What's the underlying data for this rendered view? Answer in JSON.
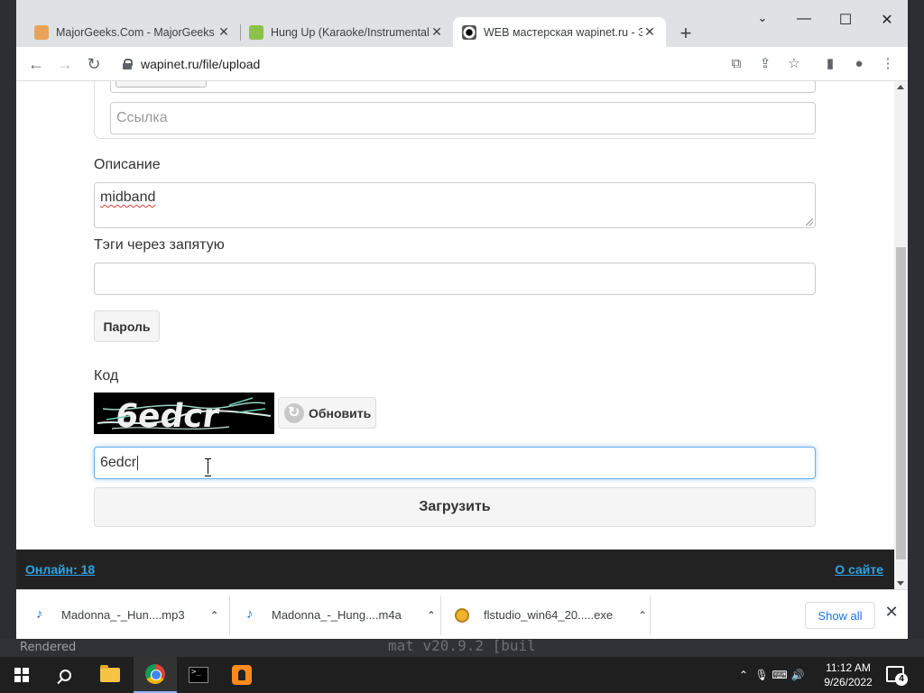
{
  "desktop": {
    "rendered_label": "Rendered",
    "background_fragment": "mat v20.9.2 [buil"
  },
  "browser": {
    "tabs": [
      {
        "label": "MajorGeeks.Com - MajorGeeks",
        "icon": "majorgeeks-icon",
        "active": false
      },
      {
        "label": "Hung Up (Karaoke/Instrumental)",
        "icon": "music-note-icon",
        "active": false
      },
      {
        "label": "WEB мастерская wapinet.ru - За",
        "icon": "wapinet-icon",
        "active": true
      }
    ],
    "url": "wapinet.ru/file/upload"
  },
  "form": {
    "link_placeholder": "Ссылка",
    "description_label": "Описание",
    "description_value": "midband",
    "tags_label": "Тэги через запятую",
    "tags_value": "",
    "password_button": "Пароль",
    "code_label": "Код",
    "captcha_text": "6edcr",
    "refresh_button": "Обновить",
    "code_value": "6edcr",
    "submit_button": "Загрузить"
  },
  "footer": {
    "online": "Онлайн: 18",
    "about": "О сайте"
  },
  "downloads": {
    "items": [
      {
        "name": "Madonna_-_Hun....mp3",
        "icon": "audio-file-icon"
      },
      {
        "name": "Madonna_-_Hung....m4a",
        "icon": "audio-file-icon"
      },
      {
        "name": "flstudio_win64_20.....exe",
        "icon": "installer-icon"
      }
    ],
    "show_all": "Show all"
  },
  "taskbar": {
    "time": "11:12 AM",
    "date": "9/26/2022",
    "notification_count": "4"
  },
  "colors": {
    "link": "#2ea3e3",
    "footer_bg": "#222222",
    "focus_ring": "#66afe9",
    "chrome_tabstrip": "#dfe1e5"
  }
}
